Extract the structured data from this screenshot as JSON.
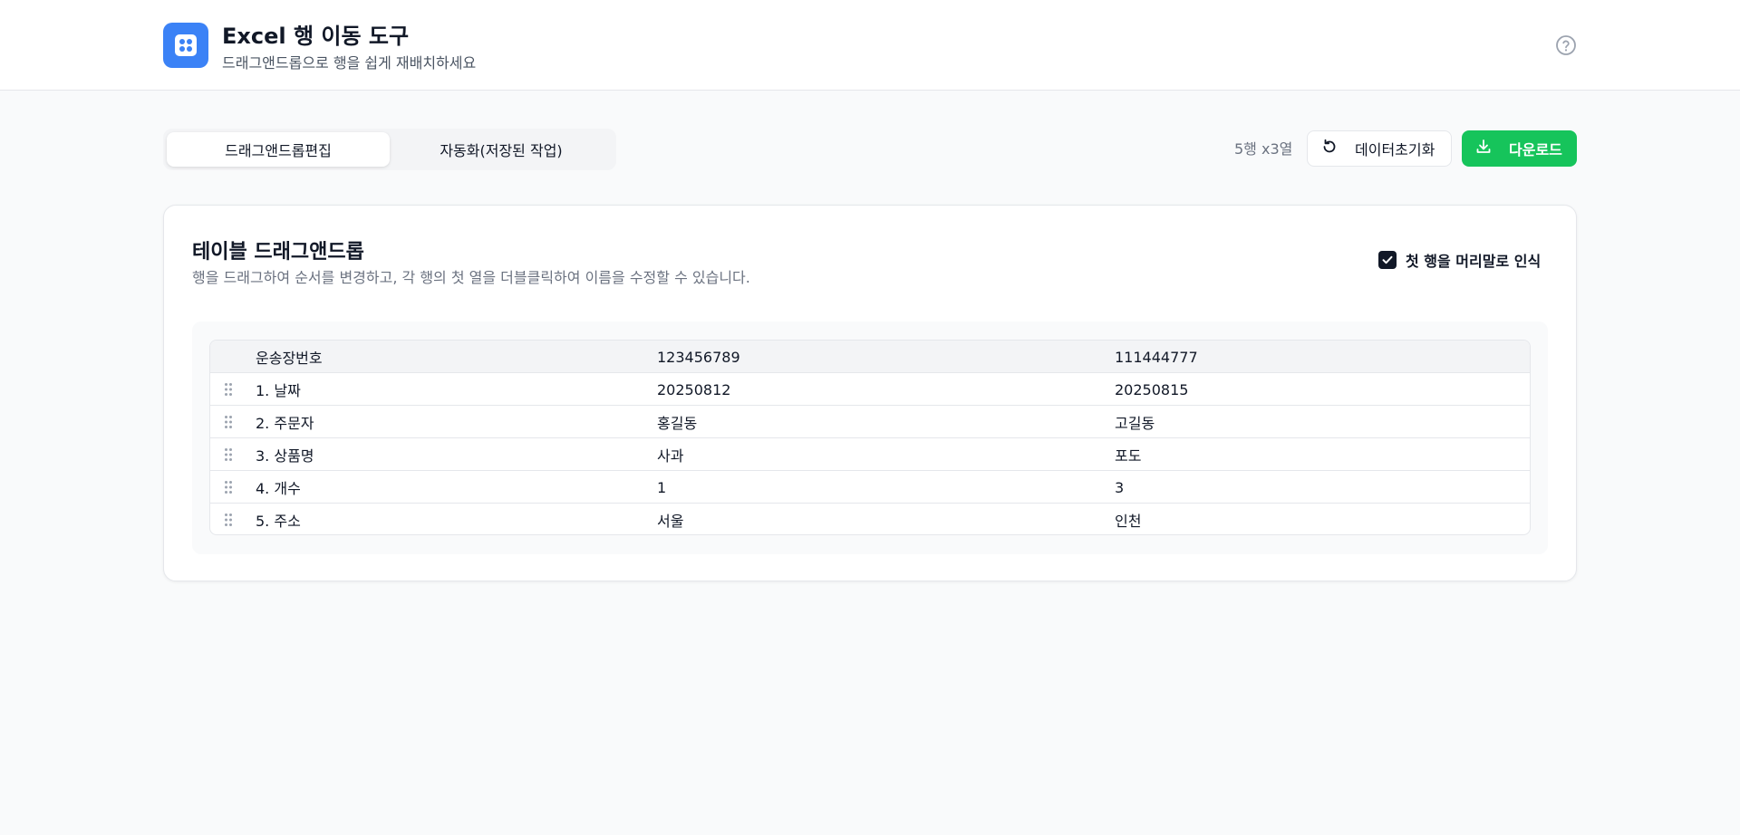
{
  "header": {
    "title": "Excel 행 이동 도구",
    "subtitle": "드래그앤드롭으로 행을 쉽게 재배치하세요",
    "logo_icon": "grid-dots-icon",
    "help_icon": "question-circle-icon",
    "accent_color": "#3b82f6"
  },
  "toolbar": {
    "tabs": [
      {
        "label": "드래그앤드롭편집",
        "active": true
      },
      {
        "label": "자동화(저장된 작업)",
        "active": false
      }
    ],
    "row_count": "5행 x3열",
    "reset_label": "데이터초기화",
    "reset_icon": "rotate-ccw-icon",
    "download_label": "다운로드",
    "download_icon": "download-icon",
    "download_color": "#16c45b"
  },
  "card": {
    "title": "테이블 드래그앤드롭",
    "description": "행을 드래그하여 순서를 변경하고, 각 행의 첫 열을 더블클릭하여 이름을 수정할 수 있습니다.",
    "header_checkbox": {
      "label": "첫 행을 머리말로 인식",
      "checked": true
    }
  },
  "table": {
    "header": [
      "운송장번호",
      "123456789",
      "111444777"
    ],
    "rows": [
      [
        "1. 날짜",
        "20250812",
        "20250815"
      ],
      [
        "2. 주문자",
        "홍길동",
        "고길동"
      ],
      [
        "3. 상품명",
        "사과",
        "포도"
      ],
      [
        "4. 개수",
        "1",
        "3"
      ],
      [
        "5. 주소",
        "서울",
        "인천"
      ]
    ],
    "drag_handle_icon": "grip-vertical-icon"
  }
}
